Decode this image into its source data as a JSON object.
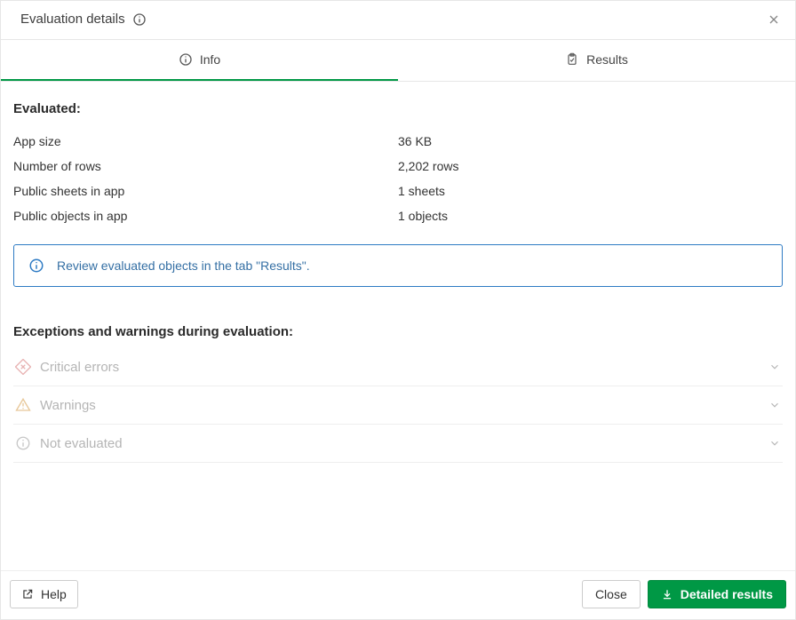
{
  "header": {
    "title": "Evaluation details"
  },
  "tabs": {
    "info": "Info",
    "results": "Results"
  },
  "evaluated": {
    "heading": "Evaluated:",
    "rows": [
      {
        "label": "App size",
        "value": "36 KB"
      },
      {
        "label": "Number of rows",
        "value": "2,202 rows"
      },
      {
        "label": "Public sheets in app",
        "value": "1 sheets"
      },
      {
        "label": "Public objects in app",
        "value": "1 objects"
      }
    ]
  },
  "alert": {
    "text": "Review evaluated objects in the tab \"Results\"."
  },
  "exceptions": {
    "heading": "Exceptions and warnings during evaluation:",
    "items": {
      "critical": "Critical errors",
      "warnings": "Warnings",
      "not_evaluated": "Not evaluated"
    }
  },
  "footer": {
    "help": "Help",
    "close": "Close",
    "detailed": "Detailed results"
  }
}
